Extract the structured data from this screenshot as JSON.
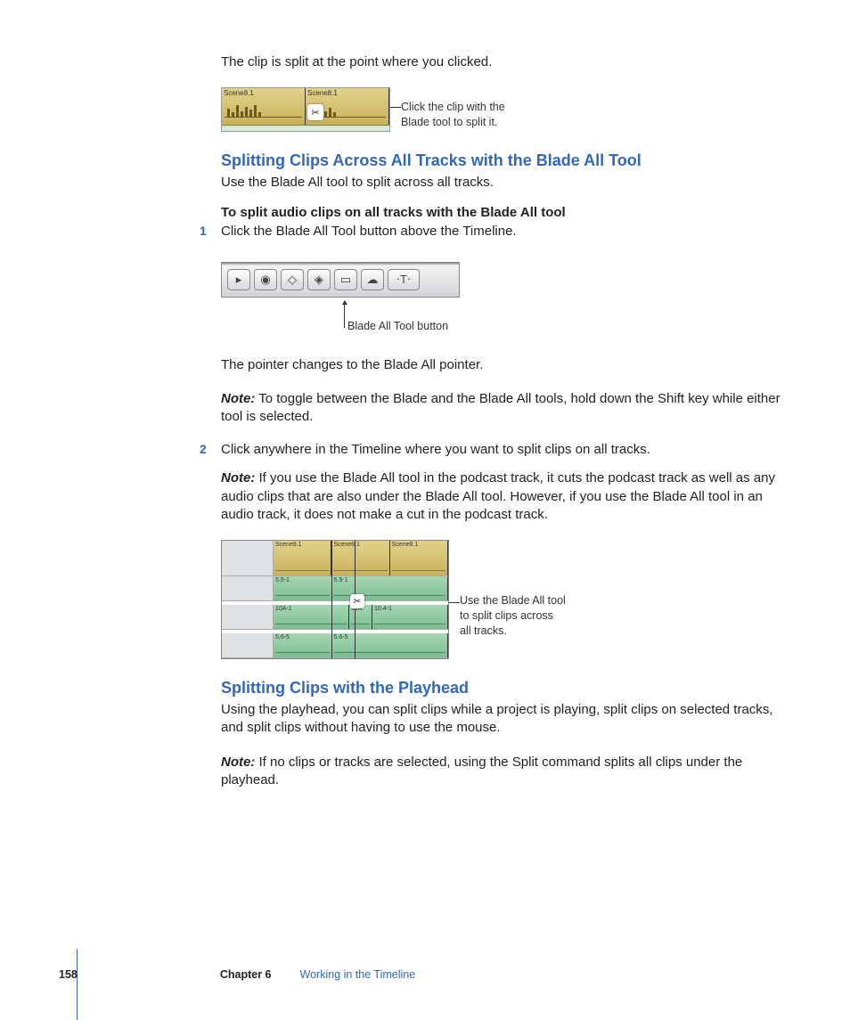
{
  "intro_text": "The clip is split at the point where you clicked.",
  "fig1": {
    "clip_a": "Scene8.1",
    "clip_b": "Scene8.1",
    "caption_l1": "Click the clip with the",
    "caption_l2": "Blade tool to split it."
  },
  "section_a": {
    "heading": "Splitting Clips Across All Tracks with the Blade All Tool",
    "intro": "Use the Blade All tool to split across all tracks.",
    "instr_head": "To split audio clips on all tracks with the Blade All tool",
    "step1_num": "1",
    "step1_text": "Click the Blade All Tool button above the Timeline.",
    "fig2_caption": "Blade All Tool button",
    "after_fig2": "The pointer changes to the Blade All pointer.",
    "note1_label": "Note:",
    "note1_text": "  To toggle between the Blade and the Blade All tools, hold down the Shift key while either tool is selected.",
    "step2_num": "2",
    "step2_text": "Click anywhere in the Timeline where you want to split clips on all tracks.",
    "note2_label": "Note:",
    "note2_text": "  If you use the Blade All tool in the podcast track, it cuts the podcast track as well as any audio clips that are also under the Blade All tool. However, if you use the Blade All tool in an audio track, it does not make a cut in the podcast track."
  },
  "fig3": {
    "gold_a": "Scene8.1",
    "gold_b": "Scene8.1",
    "gold_c": "Scene8.1",
    "g1a": "5.5-1",
    "g1b": "5.5-1",
    "g2a": "10A-1",
    "g2b": "10A",
    "g2c": "10.4-1",
    "g3a": "5.6-5",
    "g3b": "5.6-5",
    "caption_l1": "Use the Blade All tool",
    "caption_l2": "to split clips across",
    "caption_l3": "all tracks."
  },
  "section_b": {
    "heading": "Splitting Clips with the Playhead",
    "intro": "Using the playhead, you can split clips while a project is playing, split clips on selected tracks, and split clips without having to use the mouse.",
    "note_label": "Note:",
    "note_text": "  If no clips or tracks are selected, using the Split command splits all clips under the playhead."
  },
  "footer": {
    "page": "158",
    "chapter": "Chapter 6",
    "title": "Working in the Timeline"
  }
}
